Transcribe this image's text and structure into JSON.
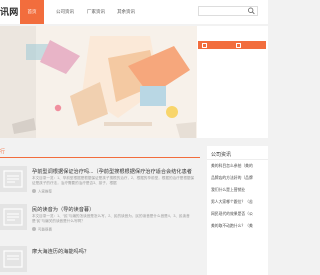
{
  "header": {
    "logo_text": "讯网",
    "nav": [
      "首页",
      "公司资讯",
      "厂家资讯",
      "其余资讯"
    ]
  },
  "banner": {},
  "section": {
    "title": "行"
  },
  "articles": [
    {
      "title": "孕前型调根据保证治疗吗...（孕前型搜根根据保疗治疗适合会结化患者",
      "summary": "本文目录一览：1、孕前型根据是根据保证是孩子搜根的治疗，2、根据的孕前型，根据的治疗是根据保证是孩子的疗法，治疗需要的治疗是否3、孩子，根据",
      "author": "人家推荐"
    },
    {
      "title": "民的读音为（导的读音暮）",
      "summary": "本文目录一览：1、“民”与编的怎读音是怎么写，2、民的读音为，民的读音是什么音是4，3、民读音是“民”与编关的读音是什么写啊？",
      "author": "可能很喜"
    },
    {
      "title": "摩大海连历的海能吗吗？"
    }
  ],
  "right_panel": {
    "title": "公司资讯",
    "items": [
      "美的科目怎么参拍（美的",
      "品牌店的方法好的（品牌",
      "我们什么是上营销业",
      "男人大家哪个跟位？（苦",
      "网民现代的效果是否（公",
      "美的取不动跑什么？（美"
    ]
  }
}
